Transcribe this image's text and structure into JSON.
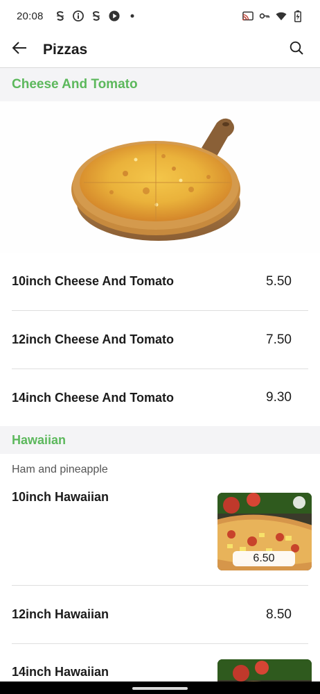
{
  "status_bar": {
    "time": "20:08",
    "left_icons": [
      "s-app-icon",
      "info-icon",
      "s-app-icon",
      "play-circle-icon",
      "dot-icon"
    ],
    "right_icons": [
      "cast-icon",
      "vpn-key-icon",
      "wifi-icon",
      "battery-icon"
    ]
  },
  "app_bar": {
    "title": "Pizzas",
    "back_icon": "arrow-back-icon",
    "search_icon": "search-icon"
  },
  "sections": [
    {
      "title": "Cheese And Tomato",
      "items": [
        {
          "name": "10inch Cheese And Tomato",
          "price": "5.50"
        },
        {
          "name": "12inch Cheese And Tomato",
          "price": "7.50"
        },
        {
          "name": "14inch Cheese And Tomato",
          "price": "9.30"
        }
      ]
    },
    {
      "title": "Hawaiian",
      "description": "Ham and pineapple",
      "items": [
        {
          "name": "10inch Hawaiian",
          "price": "6.50"
        },
        {
          "name": "12inch Hawaiian",
          "price": "8.50"
        },
        {
          "name": "14inch Hawaiian",
          "price": ""
        }
      ]
    }
  ],
  "colors": {
    "section_title": "#5cb85c",
    "section_bg": "#f4f4f6",
    "text": "#1b1b1b"
  }
}
